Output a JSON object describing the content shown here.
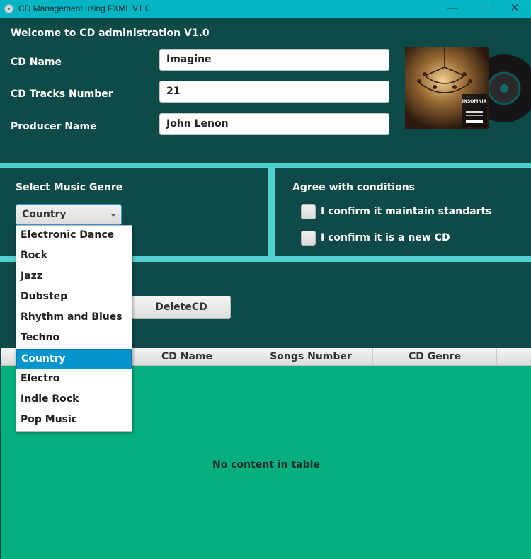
{
  "window": {
    "title": "CD Management using FXML V1.0",
    "minimize": "—",
    "maximize": "☐",
    "close": "✕"
  },
  "form": {
    "heading": "Welcome to CD administration V1.0",
    "cd_name_label": "CD Name",
    "cd_name_value": "Imagine",
    "tracks_label": "CD Tracks Number",
    "tracks_value": "21",
    "producer_label": "Producer Name",
    "producer_value": "John Lenon",
    "album_cover_text": "INSOMNIA"
  },
  "genre": {
    "label": "Select Music Genre",
    "selected": "Country",
    "options": [
      "Electronic Dance",
      "Rock",
      "Jazz",
      "Dubstep",
      "Rhythm and Blues",
      "Techno",
      "Country",
      "Electro",
      "Indie Rock",
      "Pop Music"
    ]
  },
  "conditions": {
    "label": "Agree with conditions",
    "check1_label": "I confirm it maintain standarts",
    "check1_checked": false,
    "check2_label": "I confirm it is a new CD",
    "check2_checked": false
  },
  "actions": {
    "delete_label": "DeleteCD"
  },
  "table": {
    "columns": [
      "CD Name",
      "Songs Number",
      "CD Genre"
    ],
    "placeholder": "No content in table"
  },
  "colors": {
    "titlebar": "#05b5c4",
    "panel": "#0d4a48",
    "divider": "#4fd0cf",
    "table_bg": "#05b07e",
    "selection": "#0596d0"
  }
}
